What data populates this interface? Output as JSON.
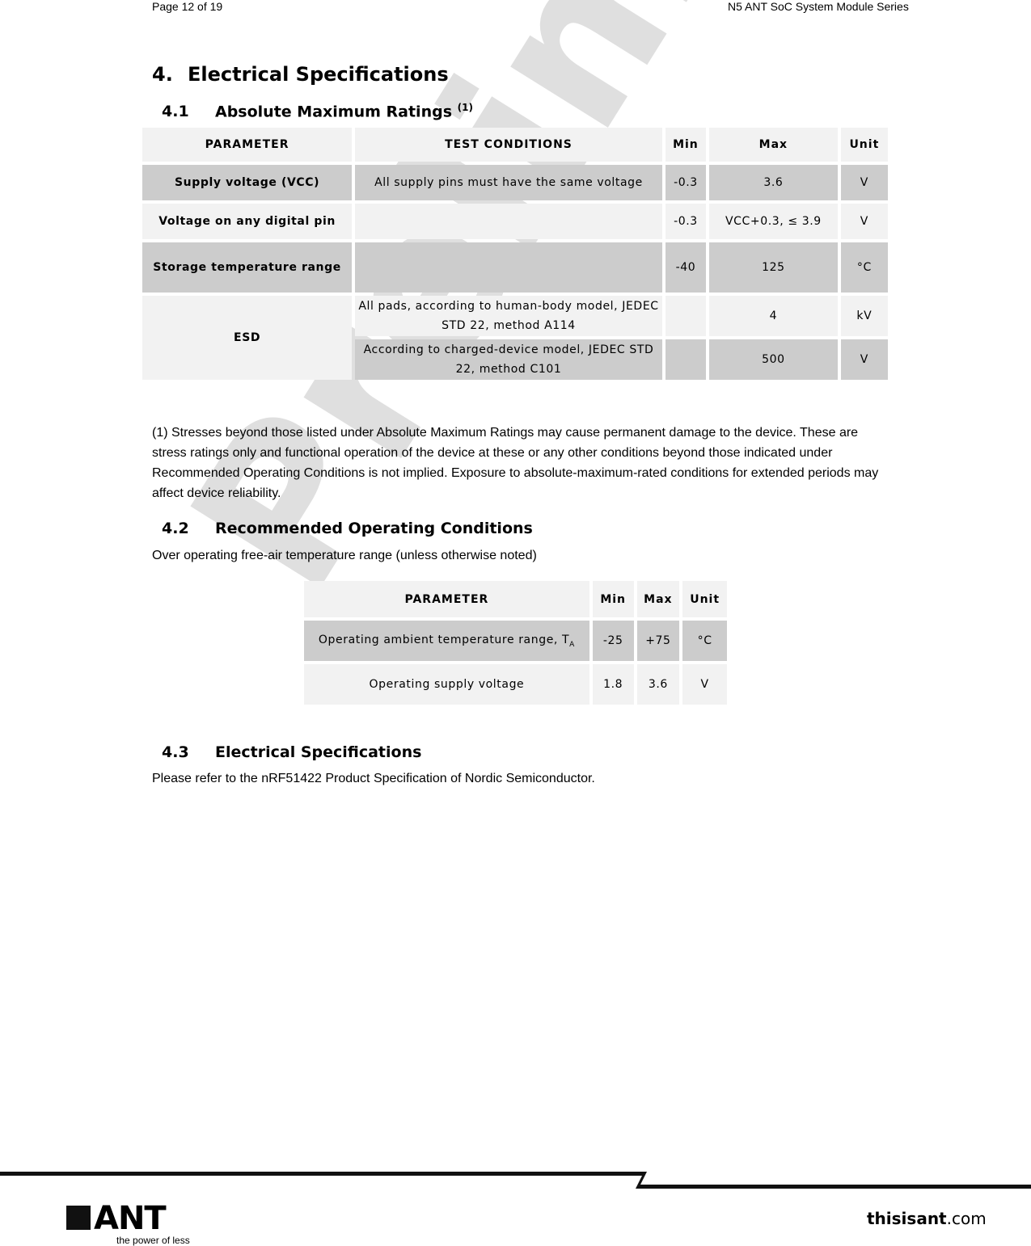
{
  "header": {
    "page": "Page 12 of 19",
    "doc_title": "N5 ANT SoC System Module Series"
  },
  "watermark": "Preliminary",
  "section4": {
    "num": "4.",
    "title": "Electrical Specifications"
  },
  "s41": {
    "num": "4.1",
    "title": "Absolute Maximum Ratings",
    "sup": "(1)"
  },
  "table1": {
    "headers": [
      "PARAMETER",
      "TEST CONDITIONS",
      "Min",
      "Max",
      "Unit"
    ],
    "rows": [
      {
        "param": "Supply voltage (VCC)",
        "cond": "All supply pins must have the same voltage",
        "min": "-0.3",
        "max": "3.6",
        "unit": "V"
      },
      {
        "param": "Voltage on any digital pin",
        "cond": "",
        "min": "-0.3",
        "max": "VCC+0.3, ≤ 3.9",
        "unit": "V"
      },
      {
        "param": "Storage temperature range",
        "cond": "",
        "min": "-40",
        "max": "125",
        "unit": "°C"
      },
      {
        "param": "ESD",
        "cond": "All pads, according to human-body model, JEDEC STD 22, method A114",
        "min": "",
        "max": "4",
        "unit": "kV"
      },
      {
        "param": "",
        "cond": "According to charged-device model, JEDEC STD 22, method C101",
        "min": "",
        "max": "500",
        "unit": "V"
      }
    ]
  },
  "footnote": "(1) Stresses beyond those listed under Absolute Maximum Ratings may cause permanent damage to the device. These are stress ratings only and functional operation of the device at these or any other conditions beyond those indicated under Recommended Operating Conditions is not implied. Exposure to absolute-maximum-rated conditions for extended periods may affect device reliability.",
  "s42": {
    "num": "4.2",
    "title": "Recommended Operating Conditions",
    "subtitle": "Over operating free-air temperature range (unless otherwise noted)"
  },
  "table2": {
    "headers": [
      "PARAMETER",
      "Min",
      "Max",
      "Unit"
    ],
    "rows": [
      {
        "param": "Operating ambient temperature range, T",
        "sub": "A",
        "min": "-25",
        "max": "+75",
        "unit": "°C"
      },
      {
        "param": "Operating supply voltage",
        "min": "1.8",
        "max": "3.6",
        "unit": "V"
      }
    ]
  },
  "s43": {
    "num": "4.3",
    "title": "Electrical Specifications",
    "text": "Please refer to the nRF51422 Product Specification of Nordic Semiconductor."
  },
  "footer": {
    "logo": "ANT",
    "tagline": "the power of less",
    "site_bold": "thisisant",
    "site_rest": ".com"
  }
}
